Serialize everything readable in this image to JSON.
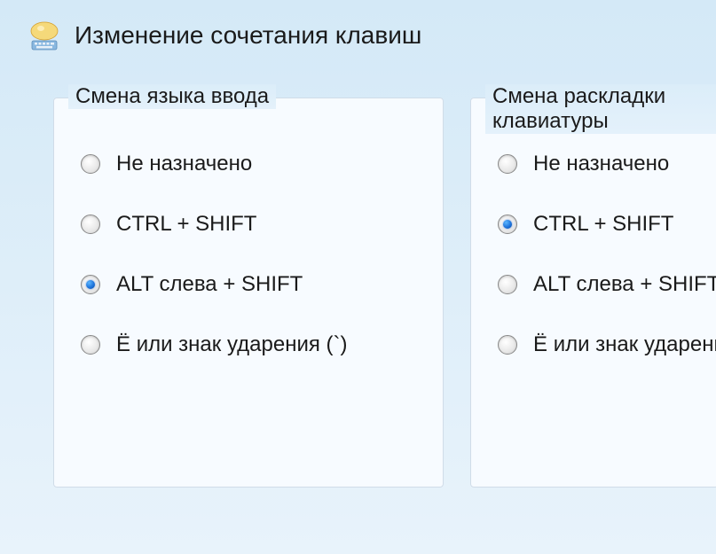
{
  "dialog": {
    "title": "Изменение сочетания клавиш"
  },
  "group_input_language": {
    "title": "Смена языка ввода",
    "options": [
      {
        "label": "Не назначено",
        "checked": false
      },
      {
        "label": "CTRL + SHIFT",
        "checked": false
      },
      {
        "label": "ALT слева + SHIFT",
        "checked": true
      },
      {
        "label": "Ё или знак ударения (`)",
        "checked": false
      }
    ]
  },
  "group_keyboard_layout": {
    "title": "Смена раскладки клавиатуры",
    "options": [
      {
        "label": "Не назначено",
        "checked": false
      },
      {
        "label": "CTRL + SHIFT",
        "checked": true
      },
      {
        "label": "ALT слева + SHIFT",
        "checked": false
      },
      {
        "label": "Ё или знак ударения (`)",
        "checked": false
      }
    ]
  }
}
